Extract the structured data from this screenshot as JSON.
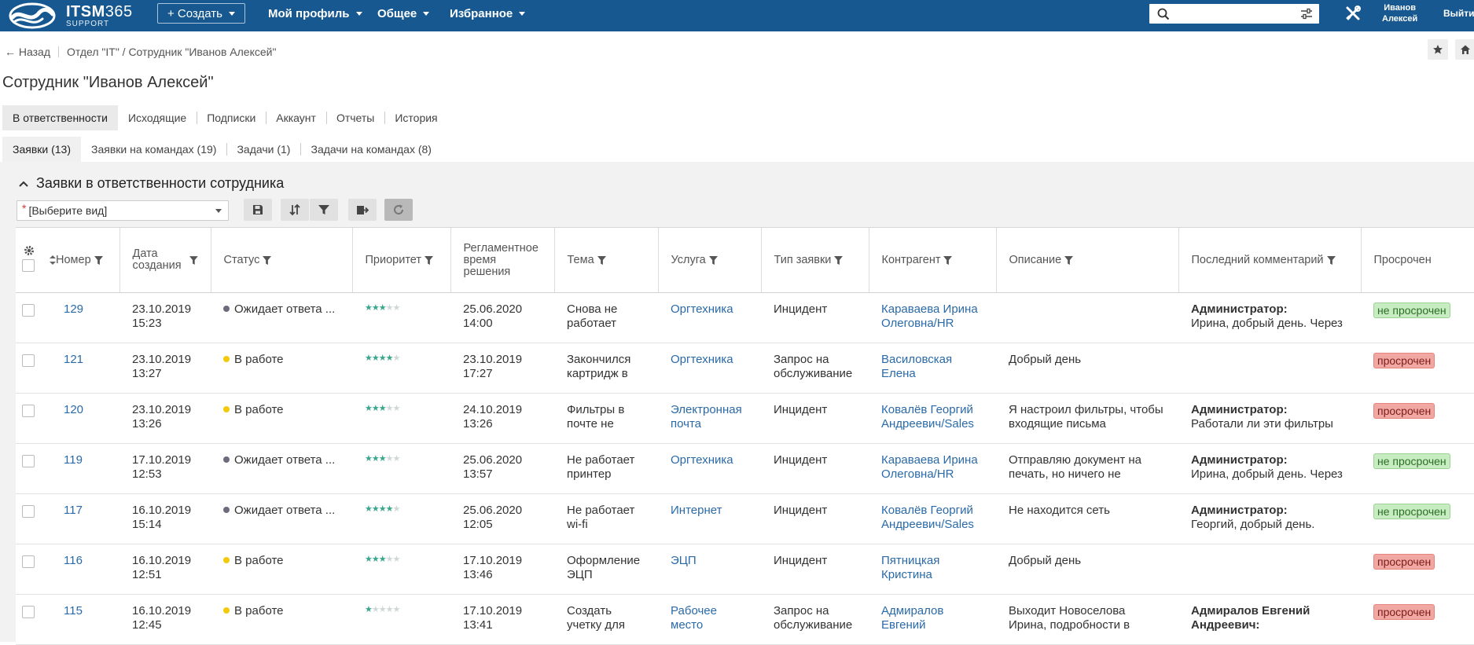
{
  "topbar": {
    "brand_main": "ITSM",
    "brand_num": "365",
    "brand_sub": "SUPPORT",
    "create_label": "+ Создать",
    "menu": [
      "Мой профиль",
      "Общее",
      "Избранное"
    ],
    "search_placeholder": "",
    "user_first": "Иванов",
    "user_last": "Алексей",
    "logout_label": "Выйти",
    "color": "#16588f"
  },
  "breadcrumb": {
    "back_label": "← Назад",
    "path": "Отдел \"IT\" / Сотрудник \"Иванов Алексей\""
  },
  "page_title": "Сотрудник \"Иванов Алексей\"",
  "tabs_primary": [
    "В ответственности",
    "Исходящие",
    "Подписки",
    "Аккаунт",
    "Отчеты",
    "История"
  ],
  "tabs_secondary": [
    "Заявки (13)",
    "Заявки на командах (19)",
    "Задачи (1)",
    "Задачи на командах (8)"
  ],
  "section_title": "Заявки в ответственности сотрудника",
  "view_select": {
    "required_mark": "*",
    "value": "[Выберите вид]"
  },
  "table": {
    "headers": {
      "number": "Номер",
      "date": "Дата создания",
      "status": "Статус",
      "priority": "Приоритет",
      "deadline": "Регламентное время решения",
      "subject": "Тема",
      "service": "Услуга",
      "type": "Тип заявки",
      "counterparty": "Контрагент",
      "description": "Описание",
      "last_comment": "Последний комментарий",
      "overdue": "Просрочен"
    },
    "rows": [
      {
        "number": "129",
        "date": "23.10.2019",
        "time": "15:23",
        "status": "Ожидает ответа ...",
        "status_color": "#6b6b7b",
        "stars": 3,
        "deadline_date": "25.06.2020",
        "deadline_time": "14:00",
        "deadline_gray": true,
        "subject": "Снова не работает",
        "service": "Оргтехника",
        "type": "Инцидент",
        "counterparty": "Караваева Ирина Олеговна/HR",
        "description": "",
        "comment_author": "Администратор:",
        "comment_text": "Ирина, добрый день. Через",
        "overdue": "не просрочен",
        "overdue_ok": true
      },
      {
        "number": "121",
        "date": "23.10.2019",
        "time": "13:27",
        "status": "В работе",
        "status_color": "#f2cc0c",
        "stars": 4,
        "deadline_date": "23.10.2019",
        "deadline_time": "17:27",
        "deadline_gray": false,
        "subject": "Закончился картридж в",
        "service": "Оргтехника",
        "type": "Запрос на обслуживание",
        "counterparty": "Василовская Елена",
        "description": "Добрый день",
        "comment_author": "",
        "comment_text": "",
        "overdue": "просрочен",
        "overdue_ok": false
      },
      {
        "number": "120",
        "date": "23.10.2019",
        "time": "13:26",
        "status": "В работе",
        "status_color": "#f2cc0c",
        "stars": 3,
        "deadline_date": "24.10.2019",
        "deadline_time": "13:26",
        "deadline_gray": false,
        "subject": "Фильтры в почте не",
        "service": "Электронная почта",
        "type": "Инцидент",
        "counterparty": "Ковалёв Георгий Андреевич/Sales",
        "description": "Я настроил фильтры, чтобы входящие письма",
        "comment_author": "Администратор:",
        "comment_text": "Работали ли эти фильтры",
        "overdue": "просрочен",
        "overdue_ok": false
      },
      {
        "number": "119",
        "date": "17.10.2019",
        "time": "12:53",
        "status": "Ожидает ответа ...",
        "status_color": "#6b6b7b",
        "stars": 3,
        "deadline_date": "25.06.2020",
        "deadline_time": "13:57",
        "deadline_gray": true,
        "subject": "Не работает принтер",
        "service": "Оргтехника",
        "type": "Инцидент",
        "counterparty": "Караваева Ирина Олеговна/HR",
        "description": "Отправляю документ на печать, но ничего не",
        "comment_author": "Администратор:",
        "comment_text": "Ирина, добрый день. Через",
        "overdue": "не просрочен",
        "overdue_ok": true
      },
      {
        "number": "117",
        "date": "16.10.2019",
        "time": "15:14",
        "status": "Ожидает ответа ...",
        "status_color": "#6b6b7b",
        "stars": 4,
        "deadline_date": "25.06.2020",
        "deadline_time": "12:05",
        "deadline_gray": true,
        "subject": "Не работает wi-fi",
        "service": "Интернет",
        "type": "Инцидент",
        "counterparty": "Ковалёв Георгий Андреевич/Sales",
        "description": "Не находится сеть",
        "comment_author": "Администратор:",
        "comment_text": "Георгий, добрый день.",
        "overdue": "не просрочен",
        "overdue_ok": true
      },
      {
        "number": "116",
        "date": "16.10.2019",
        "time": "12:51",
        "status": "В работе",
        "status_color": "#f2cc0c",
        "stars": 3,
        "deadline_date": "17.10.2019",
        "deadline_time": "13:46",
        "deadline_gray": false,
        "subject": "Оформление ЭЦП",
        "service": "ЭЦП",
        "type": "Инцидент",
        "counterparty": "Пятницкая Кристина",
        "description": "Добрый день",
        "comment_author": "",
        "comment_text": "",
        "overdue": "просрочен",
        "overdue_ok": false
      },
      {
        "number": "115",
        "date": "16.10.2019",
        "time": "12:45",
        "status": "В работе",
        "status_color": "#f2cc0c",
        "stars": 1,
        "deadline_date": "17.10.2019",
        "deadline_time": "13:41",
        "deadline_gray": false,
        "subject": "Создать учетку для",
        "service": "Рабочее место",
        "type": "Запрос на обслуживание",
        "counterparty": "Адмиралов Евгений",
        "description": "Выходит Новоселова Ирина, подробности в",
        "comment_author": "Адмиралов Евгений Андреевич:",
        "comment_text": "",
        "overdue": "просрочен",
        "overdue_ok": false
      }
    ]
  }
}
